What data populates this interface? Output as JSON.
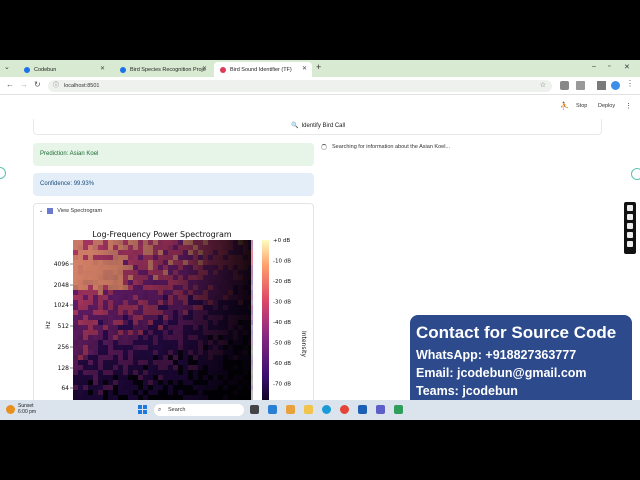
{
  "browser": {
    "tabs": [
      {
        "title": "Codebun",
        "color": "#1a73e8"
      },
      {
        "title": "Bird Species Recognition Proje",
        "color": "#1a73e8"
      },
      {
        "title": "Bird Sound Identifier (TF)",
        "color": "#e03a5a"
      }
    ],
    "url": "localhost:8501"
  },
  "app_header": {
    "stop_label": "Stop",
    "deploy_label": "Deploy"
  },
  "main": {
    "identify_label": "Identify Bird Call",
    "prediction_text": "Prediction: Asian Koel",
    "confidence_text": "Confidence: 99.93%",
    "searching_text": "Searching for information about the Asian Koel...",
    "expander_label": "View Spectrogram"
  },
  "chart_data": {
    "type": "heatmap",
    "title": "Log-Frequency Power Spectrogram",
    "ylabel": "Hz",
    "yticks": [
      "4096",
      "2048",
      "1024",
      "512",
      "256",
      "128",
      "64"
    ],
    "colorbar_label": "Intensity",
    "colorbar_ticks": [
      "+0 dB",
      "-10 dB",
      "-20 dB",
      "-30 dB",
      "-40 dB",
      "-50 dB",
      "-60 dB",
      "-70 dB"
    ],
    "colormap": [
      "#000004",
      "#3b0f70",
      "#8c2981",
      "#de4968",
      "#fe9f6d",
      "#fcfdbf"
    ]
  },
  "contact": {
    "title": "Contact for Source Code",
    "whatsapp": "WhatsApp: +918827363777",
    "email": "Email: jcodebun@gmail.com",
    "teams": "Teams: jcodebun"
  },
  "taskbar": {
    "weather_title": "Sunset",
    "weather_time": "6:00 pm",
    "search_label": "Search"
  }
}
